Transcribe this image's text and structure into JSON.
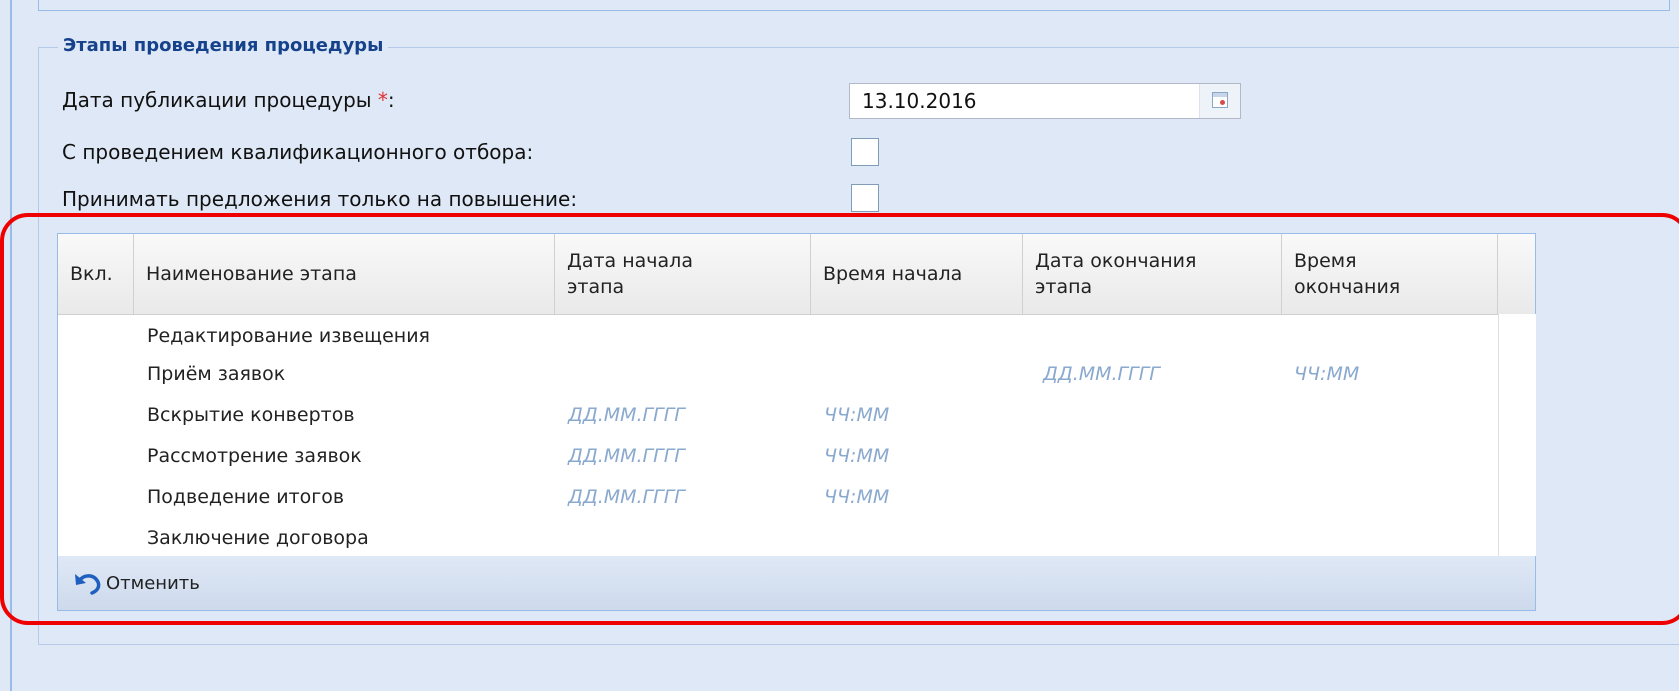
{
  "section": {
    "legend": "Этапы проведения процедуры"
  },
  "form": {
    "publication_date_label": "Дата публикации процедуры ",
    "required_mark": "*",
    "label_colon": ":",
    "publication_date_value": "13.10.2016",
    "qualification_label": "С проведением квалификационного отбора:",
    "qualification_checked": false,
    "increase_only_label": "Принимать предложения только на повышение:",
    "increase_only_checked": false
  },
  "grid": {
    "columns": [
      "Вкл.",
      "Наименование этапа",
      "Дата начала\nэтапа",
      "Время начала",
      "Дата окончания\nэтапа",
      "Время\nокончания"
    ],
    "rows": [
      {
        "name": "Редактирование извещения",
        "start_date": "",
        "start_time": "",
        "end_date": "",
        "end_time": ""
      },
      {
        "name": "Приём заявок",
        "start_date": "",
        "start_time": "",
        "end_date": "ДД.ММ.ГГГГ",
        "end_time": "ЧЧ:ММ"
      },
      {
        "name": "Вскрытие конвертов",
        "start_date": "ДД.ММ.ГГГГ",
        "start_time": "ЧЧ:ММ",
        "end_date": "",
        "end_time": ""
      },
      {
        "name": "Рассмотрение заявок",
        "start_date": "ДД.ММ.ГГГГ",
        "start_time": "ЧЧ:ММ",
        "end_date": "",
        "end_time": ""
      },
      {
        "name": "Подведение итогов",
        "start_date": "ДД.ММ.ГГГГ",
        "start_time": "ЧЧ:ММ",
        "end_date": "",
        "end_time": ""
      },
      {
        "name": "Заключение договора",
        "start_date": "",
        "start_time": "",
        "end_date": "",
        "end_time": ""
      }
    ]
  },
  "toolbar": {
    "cancel_label": "Отменить"
  },
  "icons": {
    "calendar": "calendar-icon",
    "undo": "undo-icon"
  },
  "colors": {
    "highlight": "#ee0000",
    "placeholder": "#8aa9cf",
    "legend": "#15428b"
  }
}
